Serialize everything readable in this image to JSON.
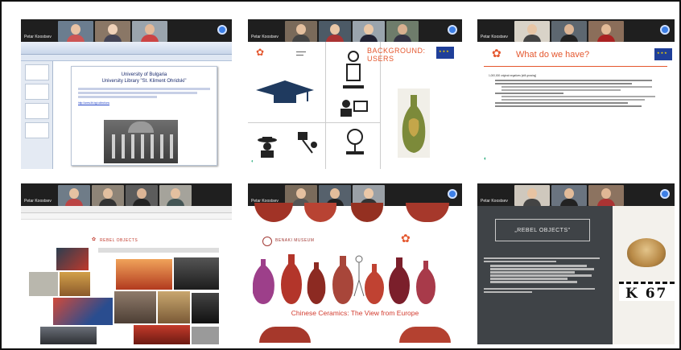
{
  "window": {
    "title": ""
  },
  "participants": {
    "screen1": "Petar Koostsev",
    "screen2": "Petar Koostsev",
    "screen3": "Petar Koostsev",
    "screen4": "Petar Koostsev",
    "screen5": "Petar Koostsev",
    "screen6": "Petar Koostsev"
  },
  "slide1": {
    "title_line1": "University of Bulgaria",
    "title_line2": "University Library \"St. Kliment Ohridski\"",
    "link": "http://www.lib.bg/collections"
  },
  "slide2": {
    "title_line1": "BACKGROUND:",
    "title_line2": "USERS"
  },
  "slide3": {
    "title": "What do we have?",
    "bullet1": "1,000,000 original negatives [still growing]"
  },
  "slide4": {
    "title": "REBEL OBJECTS"
  },
  "slide5": {
    "museum": "BENAKI MUSEUM",
    "title": "Chinese Ceramics: The View from Europe"
  },
  "slide6": {
    "box": "„REBEL OBJECTS\"",
    "label": "K 67"
  },
  "colors": {
    "accent_red": "#e4572e",
    "zoom_bar": "#1f1f1f",
    "share_blue": "#3d7fe6"
  }
}
